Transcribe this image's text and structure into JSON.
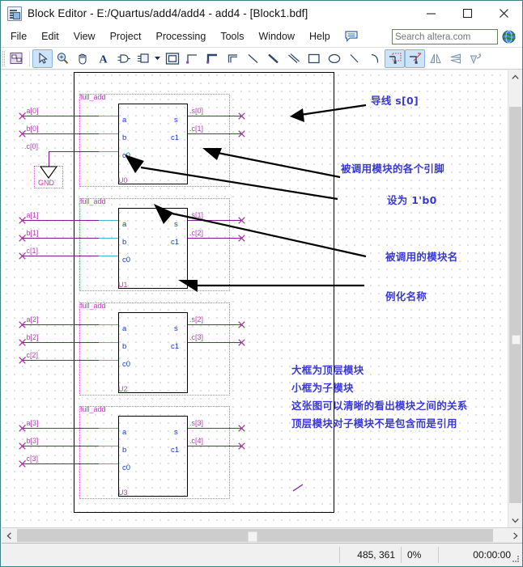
{
  "window": {
    "title": "Block Editor - E:/Quartus/add4/add4 - add4 - [Block1.bdf]",
    "icon": "block-editor-icon",
    "minimize": "minimize-button",
    "maximize": "maximize-button",
    "close": "close-button"
  },
  "menu": {
    "items": [
      {
        "label": "File"
      },
      {
        "label": "Edit"
      },
      {
        "label": "View"
      },
      {
        "label": "Project"
      },
      {
        "label": "Processing"
      },
      {
        "label": "Tools"
      },
      {
        "label": "Window"
      },
      {
        "label": "Help"
      }
    ],
    "note_icon": "note-icon"
  },
  "search": {
    "placeholder": "Search altera.com",
    "value": "",
    "globe_icon": "globe-icon"
  },
  "toolbar": {
    "buttons": [
      {
        "name": "new-block-diagram-icon",
        "active": false
      },
      {
        "name": "selection-tool-icon",
        "active": true
      },
      {
        "name": "zoom-tool-icon",
        "active": false
      },
      {
        "name": "hand-tool-icon",
        "active": false
      },
      {
        "name": "text-tool-icon",
        "active": false
      },
      {
        "name": "symbol-tool-icon",
        "active": false
      },
      {
        "name": "block-tool-icon",
        "active": false
      },
      {
        "name": "orthogonal-node-tool-icon",
        "active": false
      },
      {
        "name": "orthogonal-bus-tool-icon",
        "active": false
      },
      {
        "name": "orthogonal-conduit-tool-icon",
        "active": false
      },
      {
        "name": "diagonal-node-tool-icon",
        "active": false
      },
      {
        "name": "diagonal-bus-tool-icon",
        "active": false
      },
      {
        "name": "diagonal-conduit-tool-icon",
        "active": false
      },
      {
        "name": "rectangle-tool-icon",
        "active": false
      },
      {
        "name": "oval-tool-icon",
        "active": false
      },
      {
        "name": "line-tool-icon",
        "active": false
      },
      {
        "name": "arc-tool-icon",
        "active": false
      },
      {
        "name": "rubberbanding-icon",
        "active": true
      },
      {
        "name": "partial-line-selection-icon",
        "active": true
      },
      {
        "name": "flip-horizontal-icon",
        "active": false
      },
      {
        "name": "flip-vertical-icon",
        "active": false
      },
      {
        "name": "rotate-left-icon",
        "active": false
      }
    ]
  },
  "schematic": {
    "blocks": [
      {
        "module": "full_add",
        "instance": "U0",
        "inputs": [
          {
            "pin": "a",
            "net": ".a[0]"
          },
          {
            "pin": "b",
            "net": ".b[0]"
          },
          {
            "pin": "c0",
            "net": ".c[0]"
          }
        ],
        "outputs": [
          {
            "pin": "s",
            "net": ".s[0]"
          },
          {
            "pin": "c1",
            "net": ".c[1]"
          }
        ],
        "gnd_label": "GND"
      },
      {
        "module": "full_add",
        "instance": "U1",
        "inputs": [
          {
            "pin": "a",
            "net": ".a[1]"
          },
          {
            "pin": "b",
            "net": ".b[1]"
          },
          {
            "pin": "c0",
            "net": ".c[1]"
          }
        ],
        "outputs": [
          {
            "pin": "s",
            "net": ".s[1]"
          },
          {
            "pin": "c1",
            "net": ".c[2]"
          }
        ]
      },
      {
        "module": "full_add",
        "instance": "U2",
        "inputs": [
          {
            "pin": "a",
            "net": ".a[2]"
          },
          {
            "pin": "b",
            "net": ".b[2]"
          },
          {
            "pin": "c0",
            "net": ".c[2]"
          }
        ],
        "outputs": [
          {
            "pin": "s",
            "net": ".s[2]"
          },
          {
            "pin": "c1",
            "net": ".c[3]"
          }
        ]
      },
      {
        "module": "full_add",
        "instance": "U3",
        "inputs": [
          {
            "pin": "a",
            "net": ".a[3]"
          },
          {
            "pin": "b",
            "net": ".b[3]"
          },
          {
            "pin": "c0",
            "net": ".c[3]"
          }
        ],
        "outputs": [
          {
            "pin": "s",
            "net": ".s[3]"
          },
          {
            "pin": "c1",
            "net": ".c[4]"
          }
        ]
      }
    ],
    "annotations": [
      {
        "text": "导线 s[0]"
      },
      {
        "text": "被调用模块的各个引脚"
      },
      {
        "text": "设为 1'b0"
      },
      {
        "text": "被调用的模块名"
      },
      {
        "text": "例化名称"
      },
      {
        "text": "大框为顶层模块"
      },
      {
        "text": "小框为子模块"
      },
      {
        "text": "这张图可以清晰的看出模块之间的关系"
      },
      {
        "text": "顶层模块对子模块不是包含而是引用"
      }
    ]
  },
  "status": {
    "coords": "485, 361",
    "zoom": "0%",
    "time": "00:00:00"
  },
  "colors": {
    "wire": "#7f1f8f",
    "pin_text": "#1b3fb0",
    "net_text": "#b43fb4",
    "annotation": "#3a3ad0",
    "accent": "#3f7f8c"
  }
}
